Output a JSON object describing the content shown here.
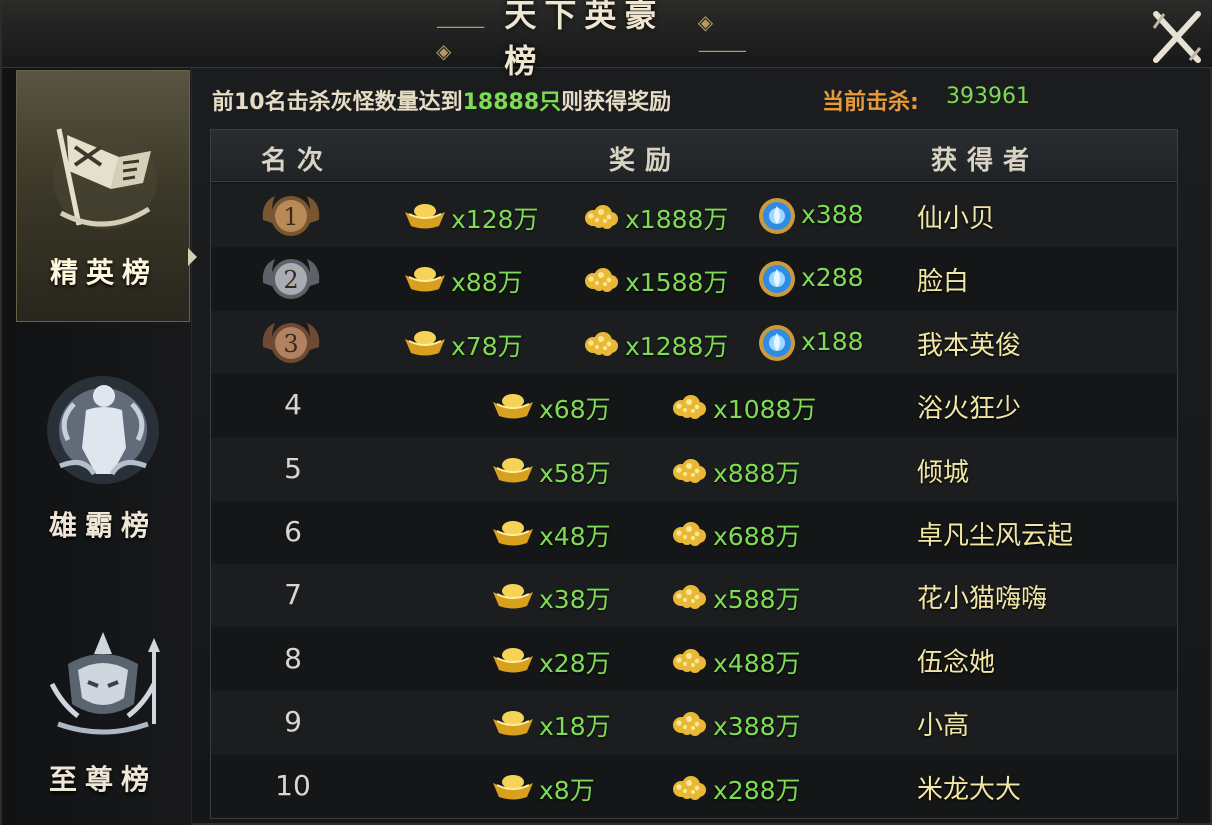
{
  "window": {
    "title": "天下英豪榜"
  },
  "sidebar": {
    "tabs": [
      {
        "label": "精英榜",
        "active": true
      },
      {
        "label": "雄霸榜",
        "active": false
      },
      {
        "label": "至尊榜",
        "active": false
      }
    ]
  },
  "notice": {
    "prefix": "前10名击杀灰怪数量达到",
    "target": "18888只",
    "suffix": "则获得奖励",
    "kill_label": "当前击杀:",
    "kill_value": "393961"
  },
  "table": {
    "headers": {
      "rank": "名次",
      "reward": "奖励",
      "winner": "获得者"
    },
    "rows": [
      {
        "rank": "1",
        "gold": "x128万",
        "coin": "x1888万",
        "orb": "x388",
        "winner": "仙小贝"
      },
      {
        "rank": "2",
        "gold": "x88万",
        "coin": "x1588万",
        "orb": "x288",
        "winner": "脸白"
      },
      {
        "rank": "3",
        "gold": "x78万",
        "coin": "x1288万",
        "orb": "x188",
        "winner": "我本英俊"
      },
      {
        "rank": "4",
        "gold": "x68万",
        "coin": "x1088万",
        "winner": "浴火狂少"
      },
      {
        "rank": "5",
        "gold": "x58万",
        "coin": "x888万",
        "winner": "倾城"
      },
      {
        "rank": "6",
        "gold": "x48万",
        "coin": "x688万",
        "winner": "卓凡尘风云起"
      },
      {
        "rank": "7",
        "gold": "x38万",
        "coin": "x588万",
        "winner": "花小猫嗨嗨"
      },
      {
        "rank": "8",
        "gold": "x28万",
        "coin": "x488万",
        "winner": "伍念她"
      },
      {
        "rank": "9",
        "gold": "x18万",
        "coin": "x388万",
        "winner": "小高"
      },
      {
        "rank": "10",
        "gold": "x8万",
        "coin": "x288万",
        "winner": "米龙大大"
      }
    ]
  },
  "icons": {
    "gold": "gold-ingot-icon",
    "coin": "gold-nugget-icon",
    "orb": "blue-orb-icon",
    "close": "close-icon"
  },
  "colors": {
    "reward_value": "#7ddc54",
    "winner_name": "#f2e6a4",
    "kill_label": "#e89a3a"
  }
}
